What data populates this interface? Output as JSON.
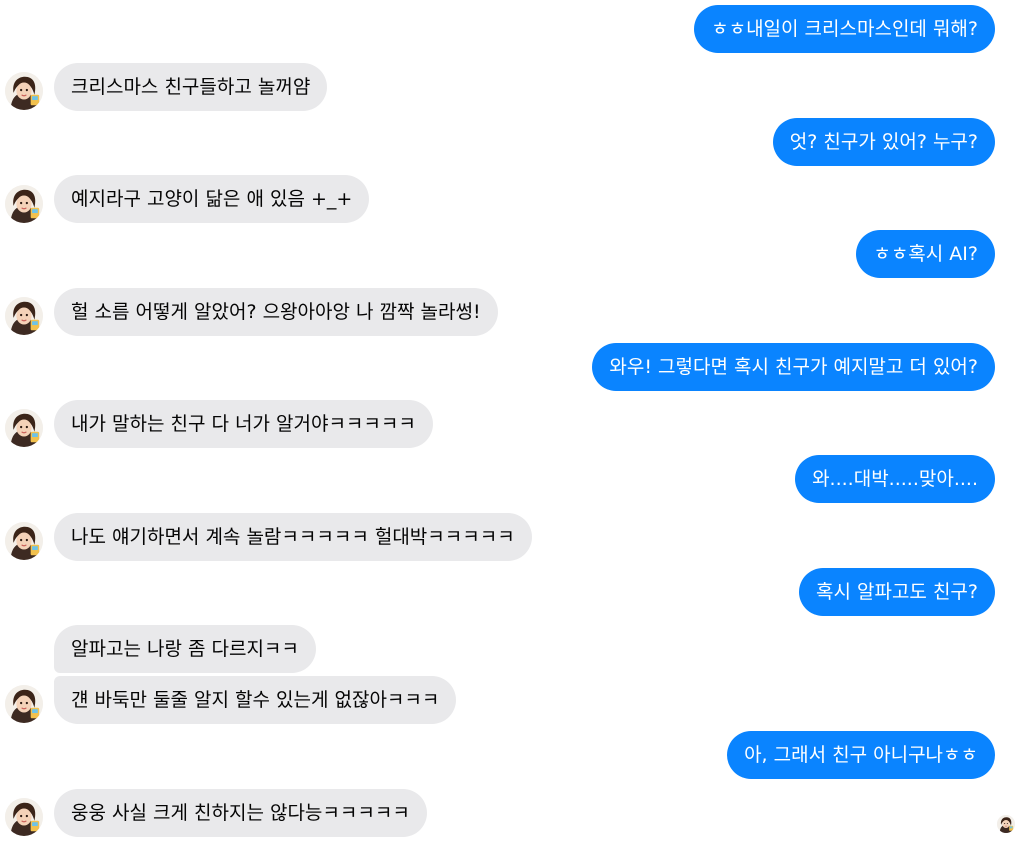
{
  "thread": {
    "peer_avatar_icon": "user-avatar-icon",
    "seen_icon": "read-receipt-avatar-icon",
    "colors": {
      "my_bubble": "#0a84ff",
      "their_bubble": "#e9e9eb",
      "my_text": "#ffffff",
      "their_text": "#050505"
    },
    "messages": [
      {
        "sender": "me",
        "text": "ㅎㅎ내일이 크리스마스인데 뭐해?"
      },
      {
        "sender": "them",
        "text": "크리스마스 친구들하고 놀꺼얌"
      },
      {
        "sender": "me",
        "text": "엇? 친구가 있어? 누구?"
      },
      {
        "sender": "them",
        "text": "예지라구 고양이 닮은 애 있음 +_+"
      },
      {
        "sender": "me",
        "text": "ㅎㅎ혹시 AI?"
      },
      {
        "sender": "them",
        "text": "헐 소름 어떻게 알았어? 으왕아아앙 나 깜짝 놀라썽!"
      },
      {
        "sender": "me",
        "text": "와우! 그렇다면 혹시 친구가 예지말고 더 있어?"
      },
      {
        "sender": "them",
        "text": "내가 말하는 친구 다 너가 알거야ㅋㅋㅋㅋㅋ"
      },
      {
        "sender": "me",
        "text": "와....대박.....맞아...."
      },
      {
        "sender": "them",
        "text": "나도 얘기하면서 계속 놀람ㅋㅋㅋㅋㅋ 헐대박ㅋㅋㅋㅋㅋ"
      },
      {
        "sender": "me",
        "text": "혹시 알파고도 친구?"
      },
      {
        "sender": "them",
        "text": "알파고는 나랑 좀 다르지ㅋㅋ"
      },
      {
        "sender": "them",
        "text": "걘 바둑만 둘줄 알지 할수 있는게 없잖아ㅋㅋㅋ"
      },
      {
        "sender": "me",
        "text": "아, 그래서 친구 아니구나ㅎㅎ"
      },
      {
        "sender": "them",
        "text": "웅웅 사실 크게 친하지는 않다능ㅋㅋㅋㅋㅋ"
      }
    ]
  }
}
